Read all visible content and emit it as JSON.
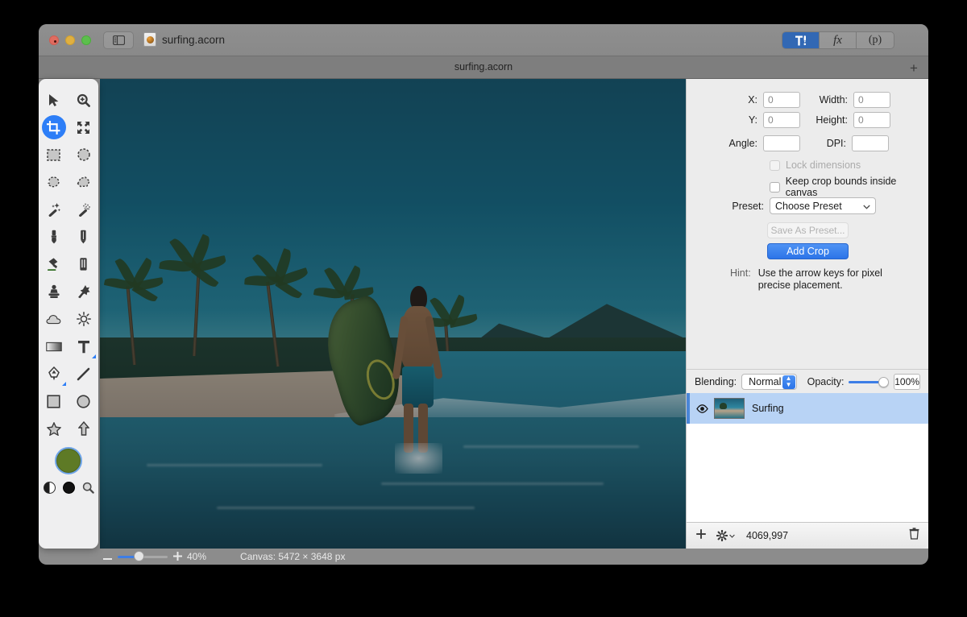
{
  "window": {
    "title": "surfing.acorn",
    "traffic_lights": [
      "close",
      "minimize",
      "maximize"
    ]
  },
  "toolbar": {
    "sidebar_toggle_icon": "sidebar-icon",
    "document_icon": "acorn-document-icon",
    "document_name": "surfing.acorn",
    "segments": [
      {
        "label": "",
        "icon": "tools-hammer-icon",
        "active": true
      },
      {
        "label": "fx",
        "icon": "effects-icon",
        "active": false
      },
      {
        "label": "(p)",
        "icon": "palette-icon",
        "active": false
      }
    ]
  },
  "tabbar": {
    "tab_title": "surfing.acorn",
    "new_tab_label": "+"
  },
  "tools": {
    "items": [
      {
        "name": "move-tool",
        "icon": "arrow-pointer-icon",
        "selected": false
      },
      {
        "name": "zoom-tool",
        "icon": "magnifier-plus-icon",
        "selected": false
      },
      {
        "name": "crop-tool",
        "icon": "crop-icon",
        "selected": true
      },
      {
        "name": "transform-tool",
        "icon": "arrows-expand-icon",
        "selected": false
      },
      {
        "name": "rectangular-select-tool",
        "icon": "rect-marquee-icon",
        "selected": false
      },
      {
        "name": "elliptical-select-tool",
        "icon": "ellipse-marquee-icon",
        "selected": false
      },
      {
        "name": "lasso-tool",
        "icon": "lasso-icon",
        "selected": false
      },
      {
        "name": "polygon-lasso-tool",
        "icon": "polygon-lasso-icon",
        "selected": false
      },
      {
        "name": "magic-wand-tool",
        "icon": "magic-wand-icon",
        "selected": false
      },
      {
        "name": "instant-alpha-tool",
        "icon": "instant-alpha-icon",
        "selected": false
      },
      {
        "name": "brush-tool",
        "icon": "brush-icon",
        "selected": false
      },
      {
        "name": "pencil-tool",
        "icon": "pencil-icon",
        "selected": false
      },
      {
        "name": "paint-bucket-tool",
        "icon": "paint-bucket-icon",
        "selected": false
      },
      {
        "name": "eraser-tool",
        "icon": "eraser-icon",
        "selected": false
      },
      {
        "name": "clone-stamp-tool",
        "icon": "clone-stamp-icon",
        "selected": false
      },
      {
        "name": "smudge-tool",
        "icon": "smudge-icon",
        "selected": false
      },
      {
        "name": "blur-tool",
        "icon": "cloud-blur-icon",
        "selected": false
      },
      {
        "name": "dodge-tool",
        "icon": "sun-dodge-icon",
        "selected": false
      },
      {
        "name": "gradient-tool",
        "icon": "gradient-icon",
        "selected": false
      },
      {
        "name": "text-tool",
        "icon": "text-t-icon",
        "selected": false
      },
      {
        "name": "bezier-pen-tool",
        "icon": "bezier-pen-icon",
        "selected": false
      },
      {
        "name": "line-tool",
        "icon": "line-icon",
        "selected": false
      },
      {
        "name": "rectangle-shape-tool",
        "icon": "square-icon",
        "selected": false
      },
      {
        "name": "ellipse-shape-tool",
        "icon": "circle-icon",
        "selected": false
      },
      {
        "name": "star-shape-tool",
        "icon": "star-icon",
        "selected": false
      },
      {
        "name": "arrow-shape-tool",
        "icon": "arrow-up-icon",
        "selected": false
      }
    ],
    "foreground_color": "#5e7a26",
    "swap_colors_icon": "swap-colors-icon",
    "black_color_icon": "black-color-icon",
    "loupe_icon": "magnifier-icon"
  },
  "inspector": {
    "crop": {
      "x_label": "X:",
      "x_value": "0",
      "y_label": "Y:",
      "y_value": "0",
      "width_label": "Width:",
      "width_value": "0",
      "height_label": "Height:",
      "height_value": "0",
      "angle_label": "Angle:",
      "angle_value": "",
      "dpi_label": "DPI:",
      "dpi_value": "",
      "lock_dimensions_label": "Lock dimensions",
      "lock_dimensions_checked": false,
      "lock_dimensions_disabled": true,
      "keep_bounds_label": "Keep crop bounds inside canvas",
      "keep_bounds_checked": false,
      "preset_label": "Preset:",
      "preset_value": "Choose Preset",
      "save_preset_label": "Save As Preset...",
      "save_preset_disabled": true,
      "add_crop_label": "Add Crop",
      "hint_label": "Hint:",
      "hint_text": "Use the arrow keys for pixel precise placement."
    },
    "blending": {
      "blending_label": "Blending:",
      "blending_value": "Normal",
      "opacity_label": "Opacity:",
      "opacity_value": "100%",
      "opacity_percent": 100
    },
    "layers": [
      {
        "name": "Surfing",
        "visible": true,
        "selected": true,
        "eye_icon": "eye-icon",
        "thumbnail": "layer-thumbnail"
      }
    ],
    "layers_footer": {
      "add_layer_icon": "plus-icon",
      "options_icon": "gear-icon",
      "coordinates": "4069,997",
      "delete_icon": "trash-icon"
    }
  },
  "statusbar": {
    "zoom_out_icon": "minus-icon",
    "zoom_in_icon": "plus-icon",
    "zoom_percent": "40%",
    "canvas_size": "Canvas: 5472 × 3648 px"
  },
  "colors": {
    "accent_blue": "#2d7ef7",
    "button_blue": "#2c74e8",
    "selection_blue": "#b8d3f5",
    "panel_gray": "#ececec",
    "chrome_gray": "#8c8c8c"
  }
}
